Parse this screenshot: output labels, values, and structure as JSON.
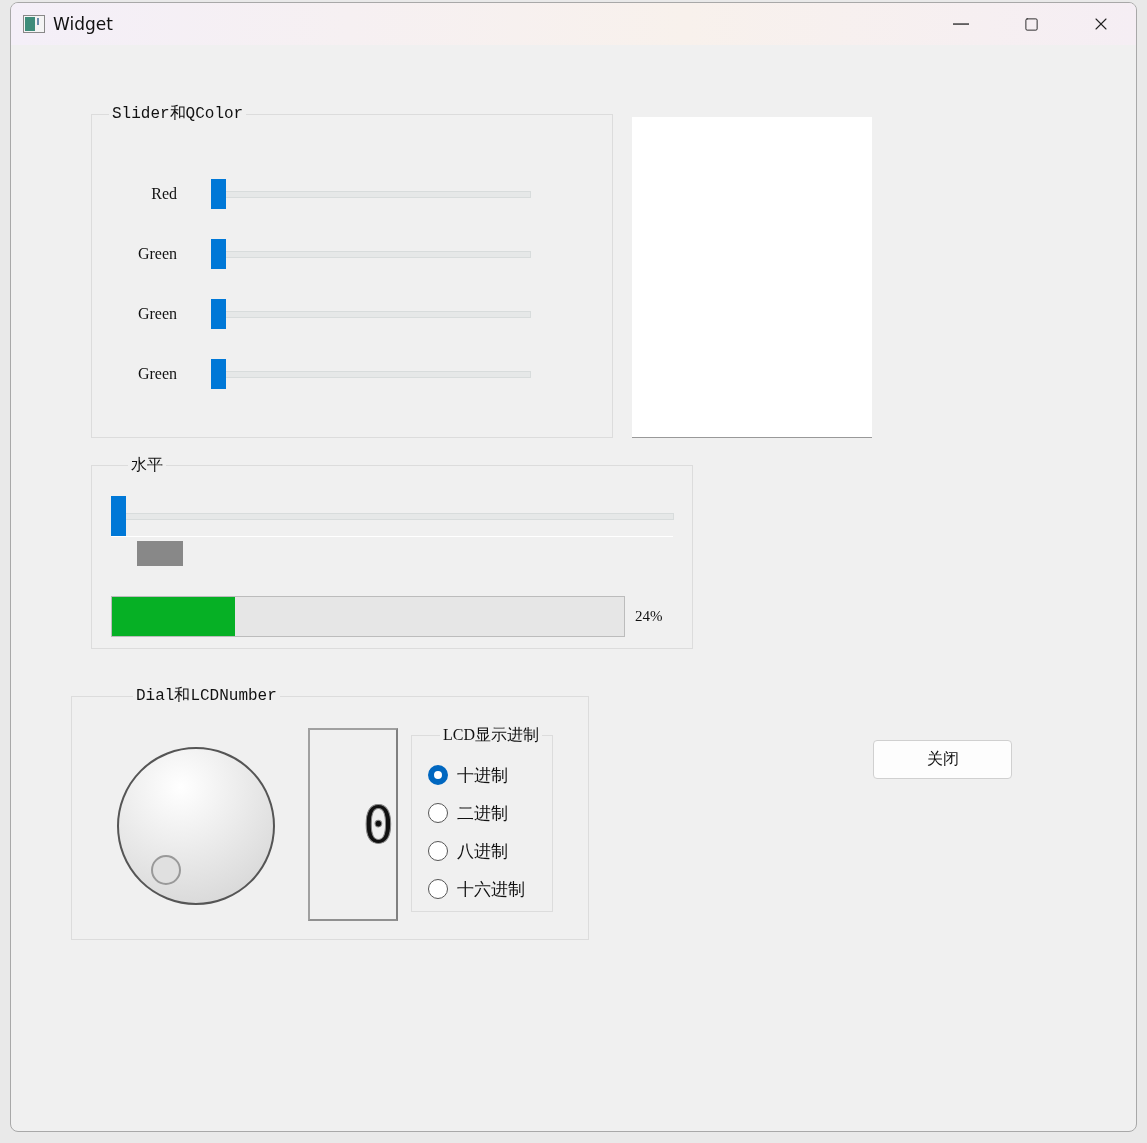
{
  "window": {
    "title": "Widget"
  },
  "color_group": {
    "title": "Slider和QColor",
    "sliders": [
      {
        "label": "Red",
        "level": 0
      },
      {
        "label": "Green",
        "level": 0
      },
      {
        "label": "Green",
        "level": 0
      },
      {
        "label": "Green",
        "level": 0
      }
    ]
  },
  "horizontal_group": {
    "title": "水平",
    "slider": {
      "level": 0
    },
    "progress": {
      "level": 0.24,
      "text": "24%"
    }
  },
  "dial_group": {
    "title": "Dial和LCDNumber",
    "lcd": {
      "value": "0"
    },
    "base_group": {
      "title": "LCD显示进制",
      "options": [
        {
          "label": "十进制",
          "selected": true
        },
        {
          "label": "二进制",
          "selected": false
        },
        {
          "label": "八进制",
          "selected": false
        },
        {
          "label": "十六进制",
          "selected": false
        }
      ]
    }
  },
  "buttons": [
    "关闭"
  ]
}
